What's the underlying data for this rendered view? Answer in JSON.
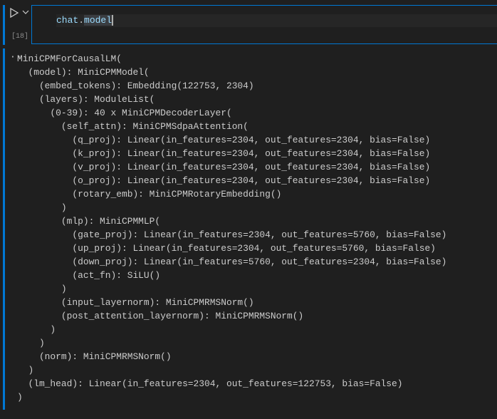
{
  "cell": {
    "execution_count": "[18]",
    "code_obj": "chat",
    "code_dot": ".",
    "code_attr": "model",
    "more_label": "···"
  },
  "output_lines": [
    "MiniCPMForCausalLM(",
    "  (model): MiniCPMModel(",
    "    (embed_tokens): Embedding(122753, 2304)",
    "    (layers): ModuleList(",
    "      (0-39): 40 x MiniCPMDecoderLayer(",
    "        (self_attn): MiniCPMSdpaAttention(",
    "          (q_proj): Linear(in_features=2304, out_features=2304, bias=False)",
    "          (k_proj): Linear(in_features=2304, out_features=2304, bias=False)",
    "          (v_proj): Linear(in_features=2304, out_features=2304, bias=False)",
    "          (o_proj): Linear(in_features=2304, out_features=2304, bias=False)",
    "          (rotary_emb): MiniCPMRotaryEmbedding()",
    "        )",
    "        (mlp): MiniCPMMLP(",
    "          (gate_proj): Linear(in_features=2304, out_features=5760, bias=False)",
    "          (up_proj): Linear(in_features=2304, out_features=5760, bias=False)",
    "          (down_proj): Linear(in_features=5760, out_features=2304, bias=False)",
    "          (act_fn): SiLU()",
    "        )",
    "        (input_layernorm): MiniCPMRMSNorm()",
    "        (post_attention_layernorm): MiniCPMRMSNorm()",
    "      )",
    "    )",
    "    (norm): MiniCPMRMSNorm()",
    "  )",
    "  (lm_head): Linear(in_features=2304, out_features=122753, bias=False)",
    ")"
  ]
}
